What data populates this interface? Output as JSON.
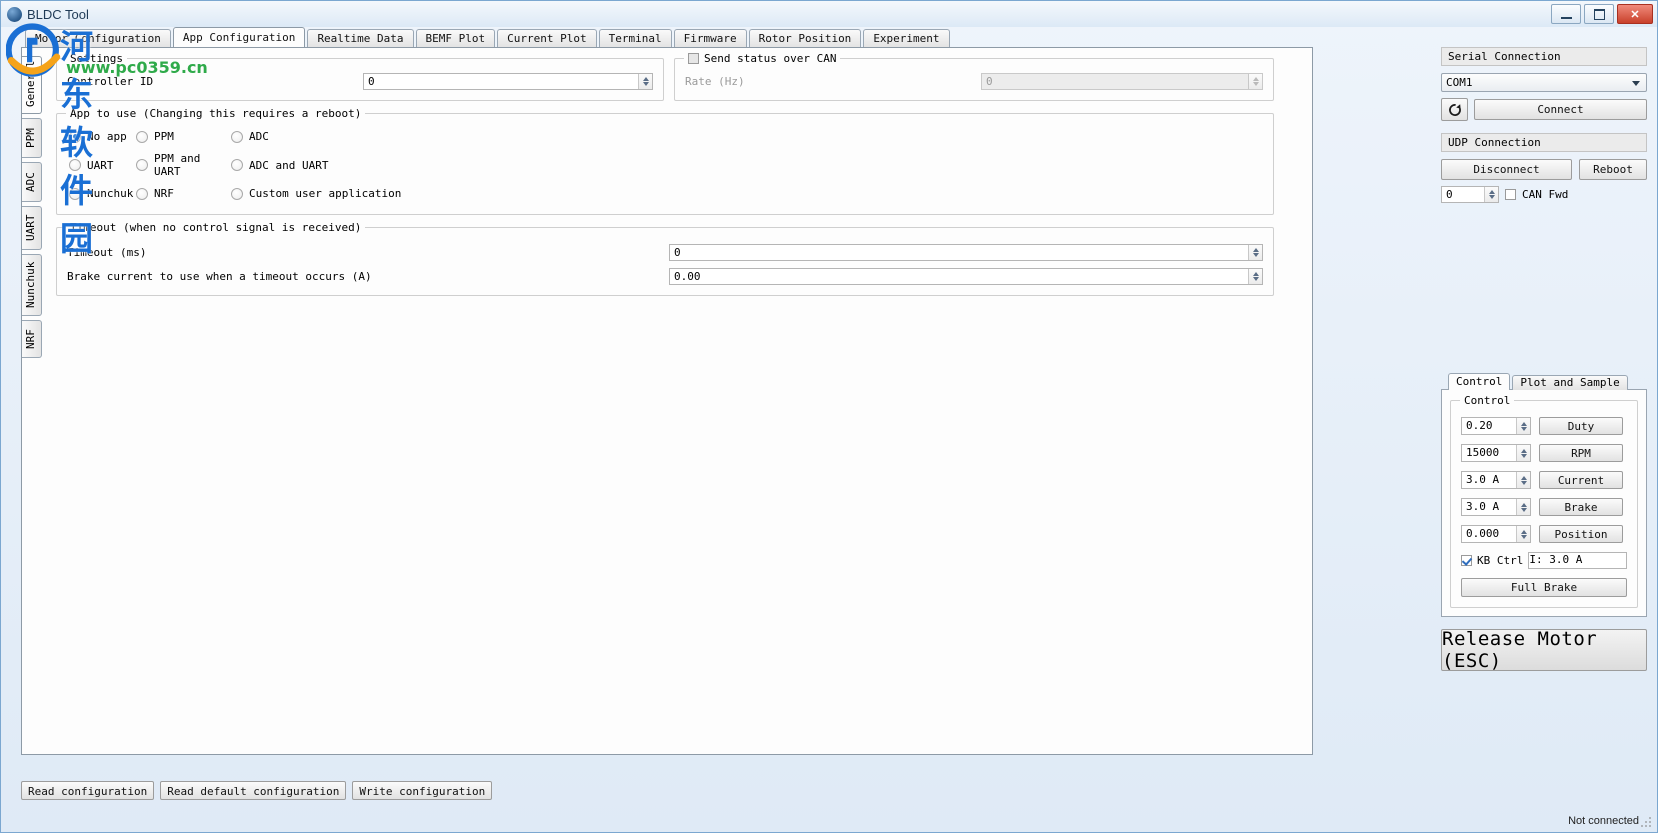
{
  "window": {
    "title": "BLDC Tool",
    "icon": "app-icon",
    "minimize": "minimize",
    "maximize": "maximize",
    "close": "close"
  },
  "watermark": {
    "chinese": "河东软件园",
    "url": "www.pc0359.cn"
  },
  "tabs": [
    {
      "label": "Motor Configuration",
      "active": false
    },
    {
      "label": "App Configuration",
      "active": true
    },
    {
      "label": "Realtime Data",
      "active": false
    },
    {
      "label": "BEMF Plot",
      "active": false
    },
    {
      "label": "Current Plot",
      "active": false
    },
    {
      "label": "Terminal",
      "active": false
    },
    {
      "label": "Firmware",
      "active": false
    },
    {
      "label": "Rotor Position",
      "active": false
    },
    {
      "label": "Experiment",
      "active": false
    }
  ],
  "vtabs": [
    {
      "label": "General",
      "active": true
    },
    {
      "label": "PPM",
      "active": false
    },
    {
      "label": "ADC",
      "active": false
    },
    {
      "label": "UART",
      "active": false
    },
    {
      "label": "Nunchuk",
      "active": false
    },
    {
      "label": "NRF",
      "active": false
    }
  ],
  "settings": {
    "title": "Settings",
    "controller_id_label": "Controller ID",
    "controller_id_value": "0"
  },
  "can": {
    "title": "Send status over CAN",
    "checked": false,
    "rate_label": "Rate (Hz)",
    "rate_value": "0",
    "disabled": true
  },
  "app_to_use": {
    "title": "App to use (Changing this requires a reboot)",
    "options": [
      {
        "label": "No app",
        "selected": true
      },
      {
        "label": "PPM",
        "selected": false
      },
      {
        "label": "ADC",
        "selected": false
      },
      {
        "label": "UART",
        "selected": false
      },
      {
        "label": "PPM and UART",
        "selected": false
      },
      {
        "label": "ADC and UART",
        "selected": false
      },
      {
        "label": "Nunchuk",
        "selected": false
      },
      {
        "label": "NRF",
        "selected": false
      },
      {
        "label": "Custom user application",
        "selected": false
      }
    ]
  },
  "timeout": {
    "title": "Timeout (when no control signal is received)",
    "ms_label": "Timeout (ms)",
    "ms_value": "0",
    "brake_label": "Brake current to use when a timeout occurs (A)",
    "brake_value": "0.00"
  },
  "config_buttons": {
    "read": "Read configuration",
    "read_default": "Read default configuration",
    "write": "Write configuration"
  },
  "serial": {
    "header": "Serial Connection",
    "port_value": "COM1",
    "refresh_icon": "refresh-icon",
    "connect": "Connect"
  },
  "udp": {
    "header": "UDP Connection",
    "disconnect": "Disconnect",
    "reboot": "Reboot",
    "id_value": "0",
    "can_fwd_label": "CAN Fwd",
    "can_fwd_checked": false
  },
  "control": {
    "tabs": [
      {
        "label": "Control",
        "active": true
      },
      {
        "label": "Plot and Sample",
        "active": false
      }
    ],
    "group_title": "Control",
    "rows": [
      {
        "value": "0.20",
        "button": "Duty"
      },
      {
        "value": "15000",
        "button": "RPM"
      },
      {
        "value": "3.0 A",
        "button": "Current"
      },
      {
        "value": "3.0 A",
        "button": "Brake"
      },
      {
        "value": "0.000",
        "button": "Position"
      }
    ],
    "kb_ctrl_label": "KB Ctrl",
    "kb_ctrl_checked": true,
    "kb_current_value": "I: 3.0 A",
    "full_brake": "Full Brake"
  },
  "release_motor": "Release Motor (ESC)",
  "statusbar": {
    "status": "Not connected"
  }
}
